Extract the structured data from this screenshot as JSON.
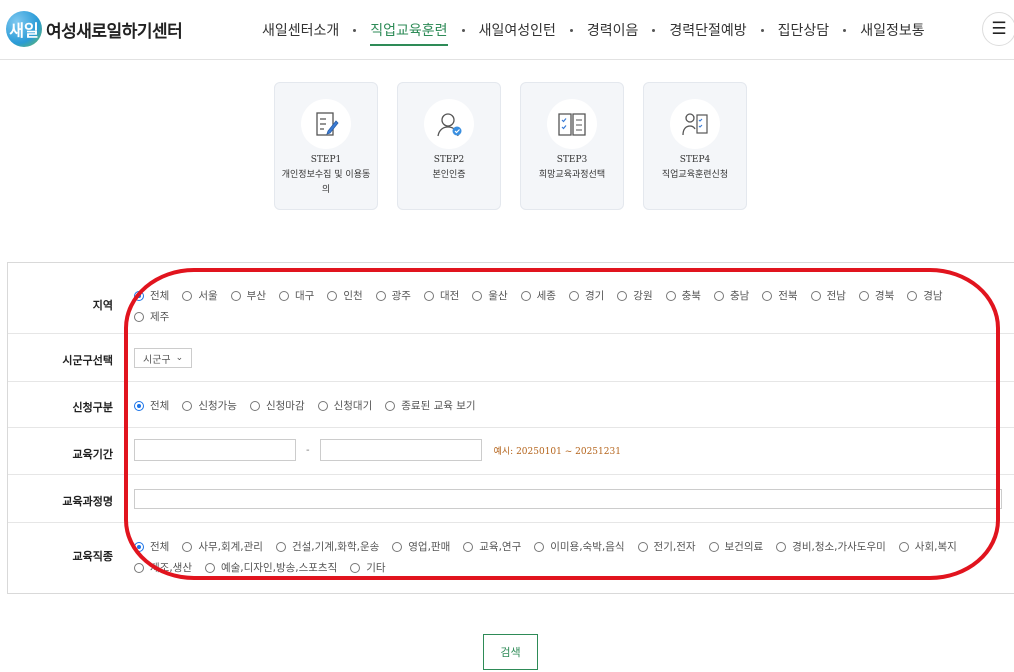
{
  "header": {
    "logo_mark": "새일",
    "logo_text": "여성새로일하기센터",
    "nav": [
      {
        "label": "새일센터소개"
      },
      {
        "label": "직업교육훈련",
        "active": true
      },
      {
        "label": "새일여성인턴"
      },
      {
        "label": "경력이음"
      },
      {
        "label": "경력단절예방"
      },
      {
        "label": "집단상담"
      },
      {
        "label": "새일정보통"
      }
    ],
    "menu_icon": "☰"
  },
  "steps": [
    {
      "title": "STEP1",
      "desc": "개인정보수집 및 이용동의",
      "icon": "document-pen-icon"
    },
    {
      "title": "STEP2",
      "desc": "본인인증",
      "icon": "user-verified-icon"
    },
    {
      "title": "STEP3",
      "desc": "희망교육과정선택",
      "icon": "book-checklist-icon"
    },
    {
      "title": "STEP4",
      "desc": "직업교육훈련신청",
      "icon": "person-checklist-icon"
    }
  ],
  "form": {
    "region": {
      "label": "지역",
      "options": [
        "전체",
        "서울",
        "부산",
        "대구",
        "인천",
        "광주",
        "대전",
        "울산",
        "세종",
        "경기",
        "강원",
        "충북",
        "충남",
        "전북",
        "전남",
        "경북",
        "경남",
        "제주"
      ],
      "selected": "전체"
    },
    "district": {
      "label": "시군구선택",
      "value": "시군구"
    },
    "apply_type": {
      "label": "신청구분",
      "options": [
        "전체",
        "신청가능",
        "신청마감",
        "신청대기",
        "종료된 교육 보기"
      ],
      "selected": "전체"
    },
    "period": {
      "label": "교육기간",
      "start": "",
      "end": "",
      "separator": "-",
      "hint": "예시: 20250101 ~ 20251231"
    },
    "course_name": {
      "label": "교육과정명",
      "value": ""
    },
    "job_type": {
      "label": "교육직종",
      "options": [
        "전체",
        "사무,회계,관리",
        "건설,기계,화학,운송",
        "영업,판매",
        "교육,연구",
        "이미용,숙박,음식",
        "전기,전자",
        "보건의료",
        "경비,청소,가사도우미",
        "사회,복지",
        "제조,생산",
        "예술,디자인,방송,스포츠직",
        "기타"
      ],
      "selected": "전체"
    }
  },
  "search_label": "검색",
  "colors": {
    "accent": "#2e8b57",
    "annotation": "#e1141e",
    "radio_checked": "#1a73e8"
  }
}
